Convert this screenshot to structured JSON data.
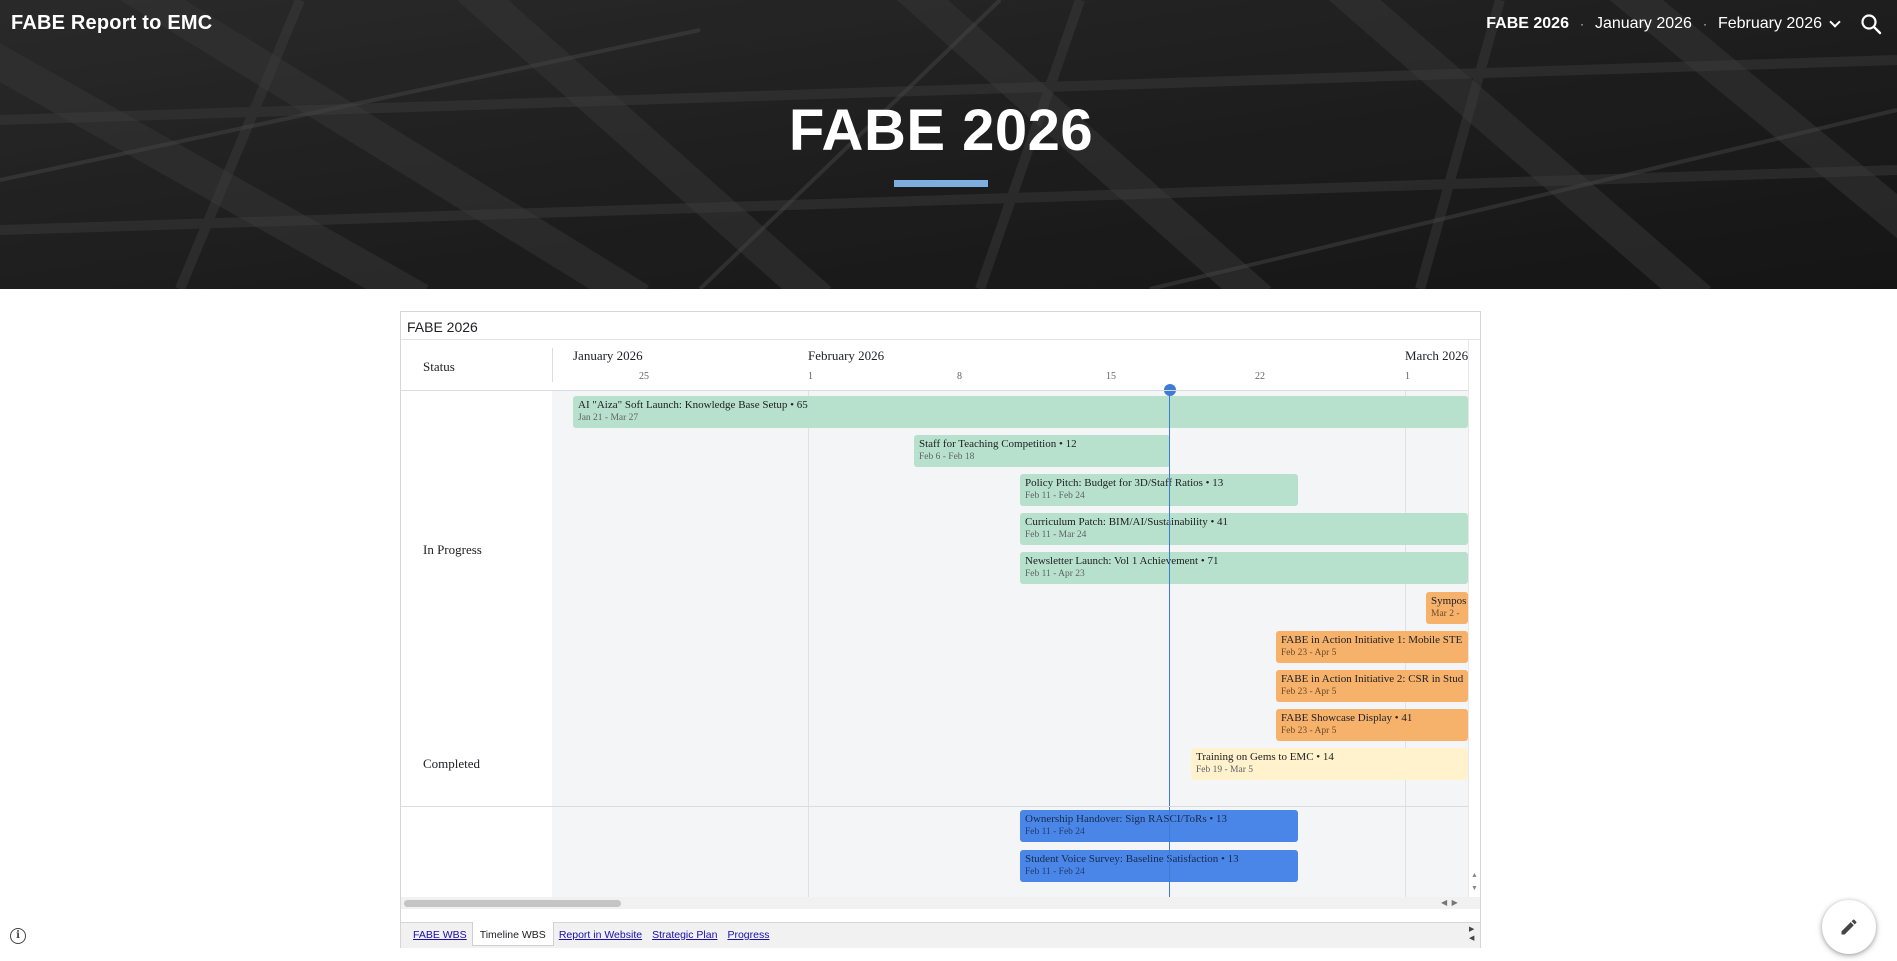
{
  "site": {
    "title": "FABE Report to EMC",
    "nav": [
      {
        "label": "FABE 2026",
        "current": true
      },
      {
        "label": "January 2026",
        "current": false
      },
      {
        "label": "February 2026",
        "current": false
      }
    ],
    "nav_separator": "·",
    "icons": {
      "search": "search-icon",
      "dropdown": "chevron-down-icon",
      "info": "info-icon",
      "edit": "pencil-icon"
    }
  },
  "hero": {
    "title": "FABE 2026",
    "accent_color": "#7eaee0"
  },
  "sheet": {
    "title": "FABE 2026",
    "group_header": "Status",
    "months": [
      "January 2026",
      "February 2026",
      "March 2026"
    ],
    "ticks": [
      "25",
      "1",
      "8",
      "15",
      "22",
      "1"
    ],
    "groups": [
      {
        "label": "In Progress",
        "tasks": [
          {
            "title": "AI \"Aiza\" Soft Launch: Knowledge Base Setup • 65",
            "dates": "Jan 21 - Mar 27",
            "color": "green"
          },
          {
            "title": "Staff for Teaching Competition • 12",
            "dates": "Feb 6 - Feb 18",
            "color": "green"
          },
          {
            "title": "Policy Pitch: Budget for 3D/Staff Ratios • 13",
            "dates": "Feb 11 - Feb 24",
            "color": "green"
          },
          {
            "title": "Curriculum Patch: BIM/AI/Sustainability • 41",
            "dates": "Feb 11 - Mar 24",
            "color": "green"
          },
          {
            "title": "Newsletter Launch: Vol 1 Achievement • 71",
            "dates": "Feb 11 - Apr 23",
            "color": "green"
          },
          {
            "title": "Sympos",
            "dates": "Mar 2 - ",
            "color": "orange"
          },
          {
            "title": "FABE in Action Initiative 1: Mobile STE",
            "dates": "Feb 23 - Apr 5",
            "color": "orange"
          },
          {
            "title": "FABE in Action Initiative 2: CSR in Stud",
            "dates": "Feb 23 - Apr 5",
            "color": "orange"
          },
          {
            "title": "FABE Showcase Display • 41",
            "dates": "Feb 23 - Apr 5",
            "color": "orange"
          },
          {
            "title": "Training on Gems to EMC • 14",
            "dates": "Feb 19 - Mar 5",
            "color": "yellow"
          }
        ]
      },
      {
        "label": "Completed",
        "tasks": [
          {
            "title": "Ownership Handover: Sign RASCI/ToRs • 13",
            "dates": "Feb 11 - Feb 24",
            "color": "blue"
          },
          {
            "title": "Student Voice Survey: Baseline Satisfaction • 13",
            "dates": "Feb 11 - Feb 24",
            "color": "blue"
          }
        ]
      }
    ],
    "colors": {
      "green": "#b7e1cd",
      "orange": "#f6b26b",
      "yellow": "#fff2cc",
      "blue": "#4a86e8",
      "today": "#3e7bd7"
    },
    "tabs": [
      {
        "label": "FABE WBS",
        "active": false
      },
      {
        "label": "Timeline WBS",
        "active": true
      },
      {
        "label": "Report in Website",
        "active": false
      },
      {
        "label": "Strategic Plan",
        "active": false
      },
      {
        "label": "Progress",
        "active": false
      }
    ]
  }
}
